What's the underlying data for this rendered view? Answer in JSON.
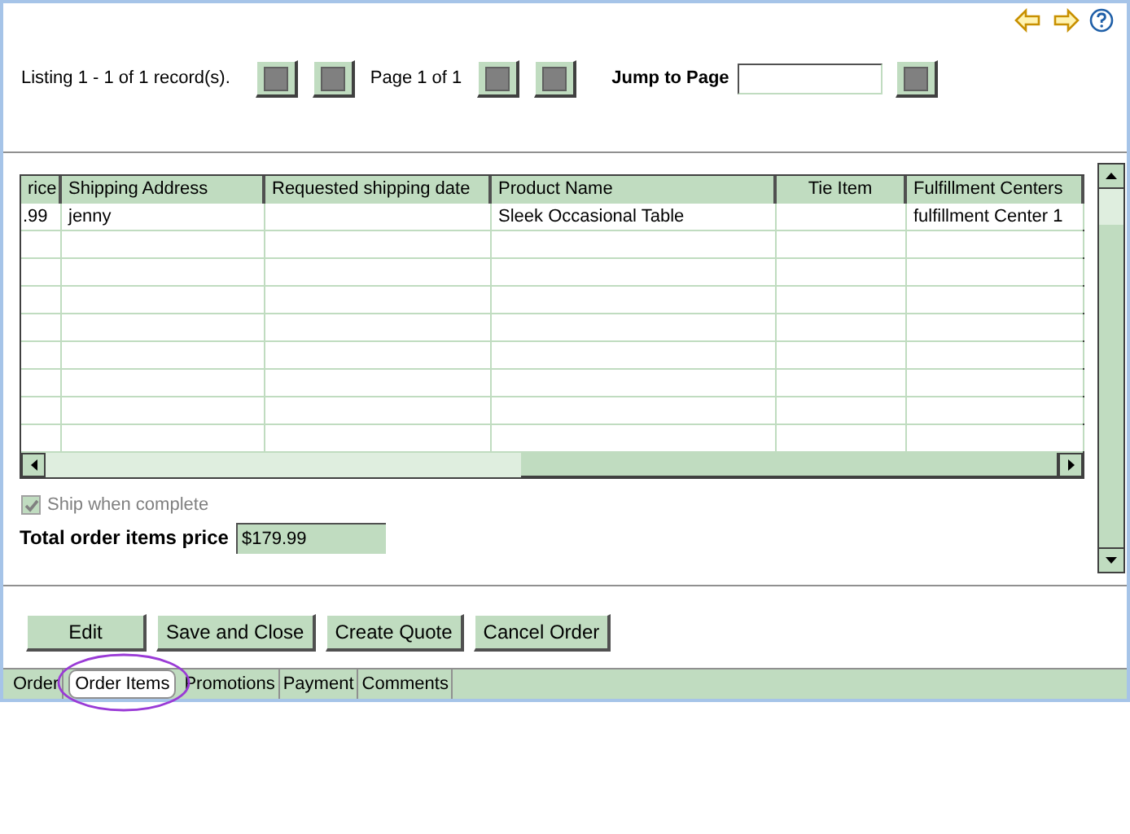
{
  "pager": {
    "listing": "Listing 1 - 1 of 1 record(s).",
    "page": "Page 1 of 1",
    "jump_label": "Jump to Page"
  },
  "table": {
    "columns": [
      "rice",
      "Shipping Address",
      "Requested shipping date",
      "Product Name",
      "Tie Item",
      "Fulfillment Centers"
    ],
    "rows": [
      [
        ".99",
        "jenny",
        "",
        "Sleek Occasional Table",
        "",
        "fulfillment Center 1"
      ]
    ]
  },
  "ship_when_complete": {
    "label": "Ship when complete",
    "checked": true,
    "disabled": true
  },
  "total": {
    "label": "Total order items price",
    "value": "$179.99"
  },
  "buttons": [
    "Edit",
    "Save and Close",
    "Create Quote",
    "Cancel Order"
  ],
  "tabs": [
    {
      "label": "Order",
      "selected": false
    },
    {
      "label": "Order Items",
      "selected": true
    },
    {
      "label": "Promotions",
      "selected": false
    },
    {
      "label": "Payment",
      "selected": false
    },
    {
      "label": "Comments",
      "selected": false
    }
  ]
}
